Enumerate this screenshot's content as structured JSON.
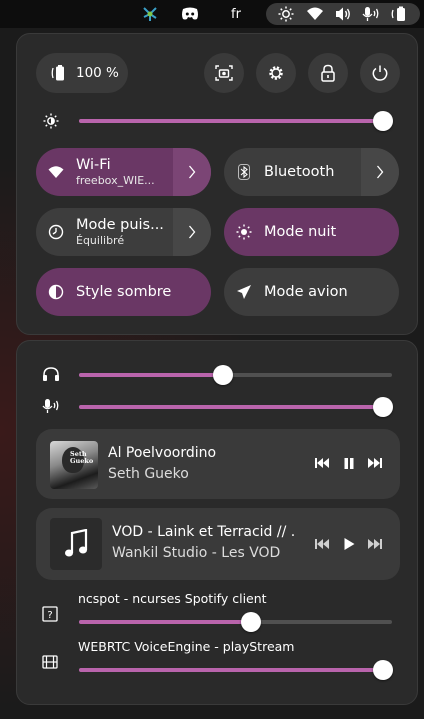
{
  "topbar": {
    "language": "fr",
    "tray_icons": [
      "kde-connect-icon",
      "discord-icon"
    ],
    "status_icons": [
      "brightness-icon",
      "wifi-icon",
      "volume-icon",
      "microphone-icon",
      "battery-icon"
    ]
  },
  "header": {
    "battery_label": "100 %",
    "buttons": [
      "screenshot-icon",
      "settings-icon",
      "lock-icon",
      "power-icon"
    ]
  },
  "brightness": {
    "level": 1.0
  },
  "toggles": {
    "wifi": {
      "label": "Wi-Fi",
      "sub": "freebox_WIE...",
      "active": true
    },
    "bluetooth": {
      "label": "Bluetooth",
      "active": false
    },
    "power_mode": {
      "label": "Mode puis...",
      "sub": "Équilibré",
      "active": false
    },
    "night_mode": {
      "label": "Mode nuit",
      "active": true
    },
    "dark_style": {
      "label": "Style sombre",
      "active": true
    },
    "airplane": {
      "label": "Mode avion",
      "active": false
    }
  },
  "audio": {
    "output_level": 0.46,
    "input_level": 1.0
  },
  "media": [
    {
      "title": "Al Poelvoordino",
      "artist": "Seth Gueko",
      "state": "playing",
      "art_text": "Seth Gueko"
    },
    {
      "title": "VOD - Laink et Terracid // ...",
      "artist": "Wankil Studio - Les VOD",
      "state": "paused"
    }
  ],
  "streams": [
    {
      "label": "ncspot - ncurses Spotify client",
      "level": 0.55
    },
    {
      "label": "WEBRTC VoiceEngine - playStream",
      "level": 1.0
    }
  ],
  "colors": {
    "accent": "#b964ac",
    "toggle_on": "#6a3765",
    "panel": "#2a2a2a"
  }
}
